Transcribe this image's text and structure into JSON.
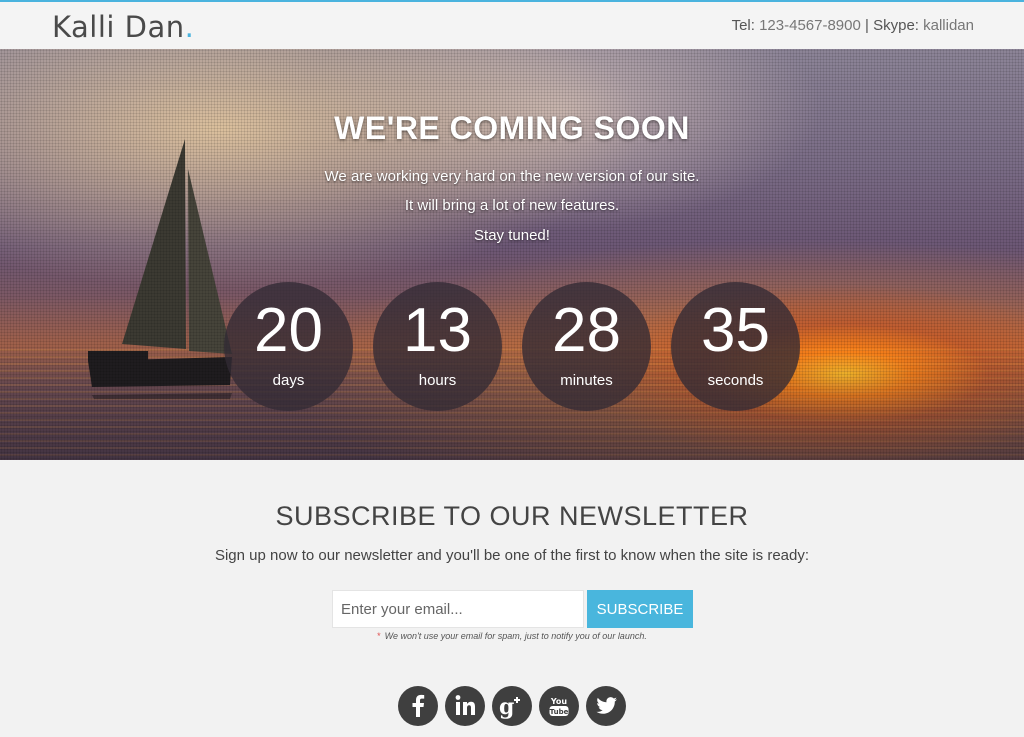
{
  "header": {
    "logo_text": "Kalli Dan",
    "logo_dot": ".",
    "tel_label": "Tel:",
    "tel_value": "123-4567-8900",
    "separator": "|",
    "skype_label": "Skype:",
    "skype_value": "kallidan"
  },
  "hero": {
    "title": "WE'RE COMING SOON",
    "lines": [
      "We are working very hard on the new version of our site.",
      "It will bring a lot of new features.",
      "Stay tuned!"
    ],
    "countdown": [
      {
        "value": "20",
        "unit": "days"
      },
      {
        "value": "13",
        "unit": "hours"
      },
      {
        "value": "28",
        "unit": "minutes"
      },
      {
        "value": "35",
        "unit": "seconds"
      }
    ]
  },
  "newsletter": {
    "title": "SUBSCRIBE TO OUR NEWSLETTER",
    "text": "Sign up now to our newsletter and you'll be one of the first to know when the site is ready:",
    "email_placeholder": "Enter your email...",
    "button_label": "SUBSCRIBE",
    "note_star": "*",
    "note": "We won't use your email for spam, just to notify you of our launch."
  },
  "social": [
    {
      "icon": "facebook-icon",
      "glyph": "f"
    },
    {
      "icon": "linkedin-icon",
      "glyph": "in"
    },
    {
      "icon": "google-plus-icon",
      "glyph": "g+"
    },
    {
      "icon": "youtube-icon",
      "glyph": "You Tube"
    },
    {
      "icon": "twitter-icon",
      "glyph": ""
    }
  ],
  "colors": {
    "accent": "#4ab3de",
    "button": "#49b6dd",
    "social_bg": "#3f3f3f",
    "text": "#444444"
  }
}
